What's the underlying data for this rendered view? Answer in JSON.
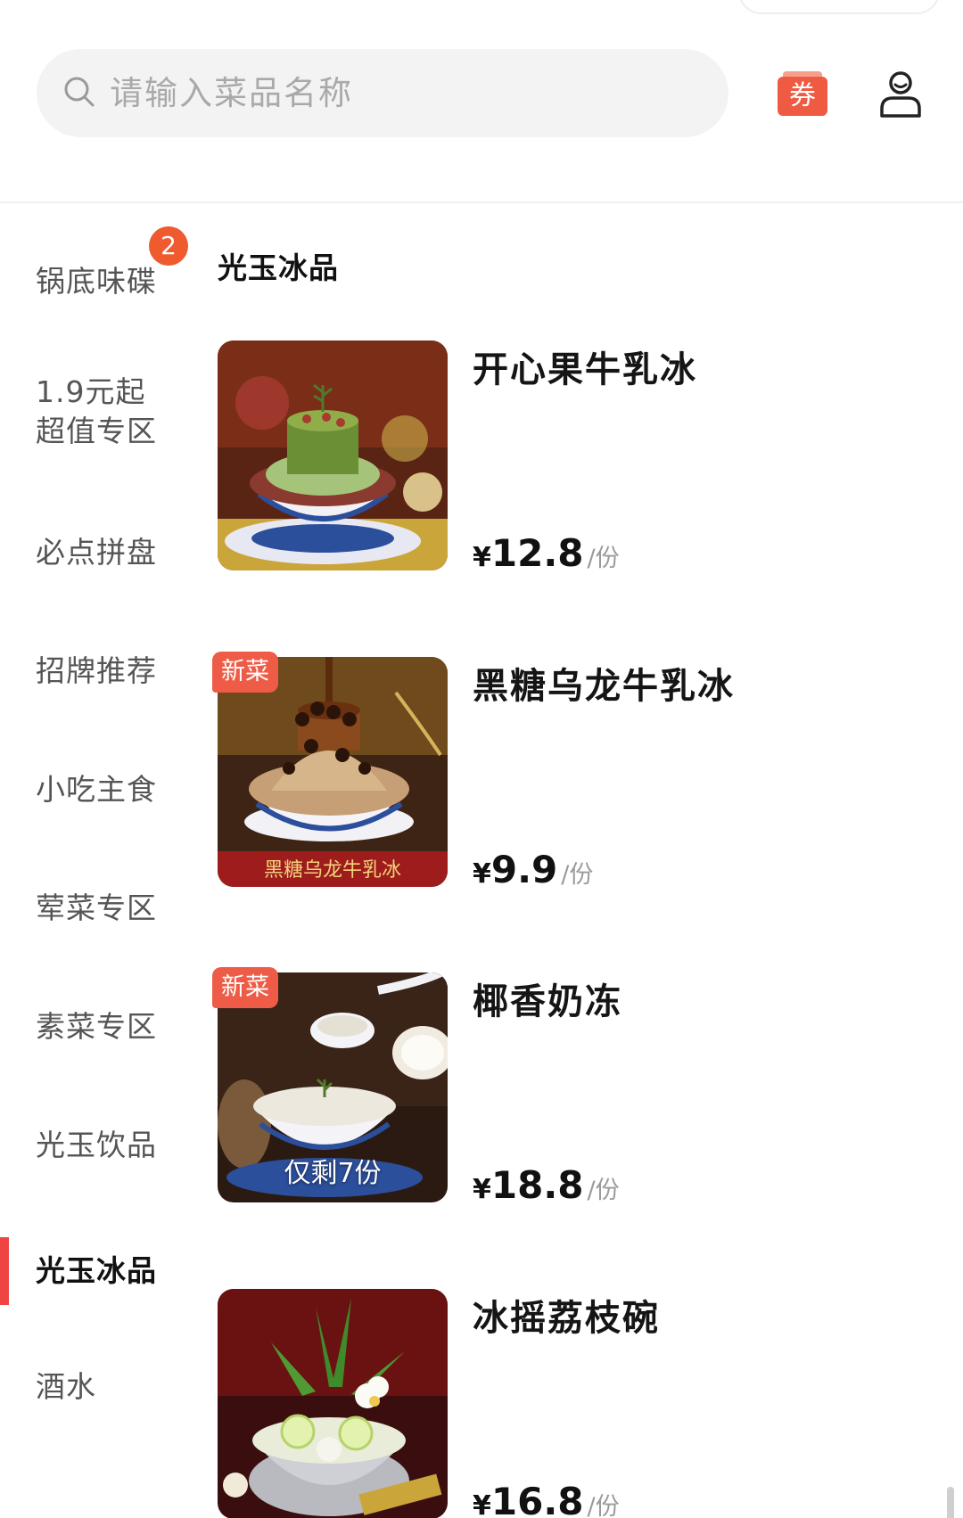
{
  "search": {
    "placeholder": "请输入菜品名称"
  },
  "header": {
    "coupon_label": "券"
  },
  "sidebar": {
    "items": [
      {
        "label": "锅底味碟",
        "badge": "2"
      },
      {
        "label_line1": "1.9元起",
        "label_line2": "超值专区"
      },
      {
        "label": "必点拼盘"
      },
      {
        "label": "招牌推荐"
      },
      {
        "label": "小吃主食"
      },
      {
        "label": "荤菜专区"
      },
      {
        "label": "素菜专区"
      },
      {
        "label": "光玉饮品"
      },
      {
        "label": "光玉冰品",
        "active": true
      },
      {
        "label": "酒水"
      }
    ]
  },
  "section": {
    "title": "光玉冰品"
  },
  "dishes": [
    {
      "name": "开心果牛乳冰",
      "currency": "¥",
      "price": "12.8",
      "unit": "/份"
    },
    {
      "name": "黑糖乌龙牛乳冰",
      "currency": "¥",
      "price": "9.9",
      "unit": "/份",
      "badge": "新菜",
      "image_caption": "黑糖乌龙牛乳冰"
    },
    {
      "name": "椰香奶冻",
      "currency": "¥",
      "price": "18.8",
      "unit": "/份",
      "badge": "新菜",
      "stock": "仅剩7份"
    },
    {
      "name": "冰摇荔枝碗",
      "currency": "¥",
      "price": "16.8",
      "unit": "/份"
    }
  ],
  "colors": {
    "accent": "#ef4444",
    "badge": "#ee5b46",
    "search_bg": "#f3f3f3"
  }
}
